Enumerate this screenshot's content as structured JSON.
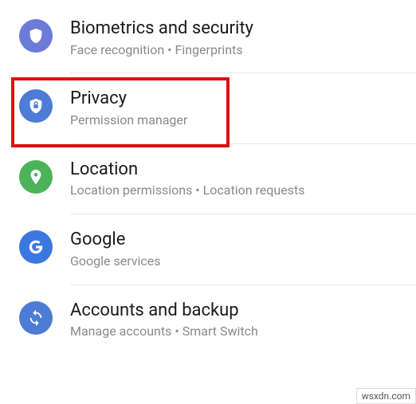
{
  "items": [
    {
      "title": "Biometrics and security",
      "subtitle": "Face recognition  •  Fingerprints",
      "icon": "shield",
      "color": "#6b7bd6"
    },
    {
      "title": "Privacy",
      "subtitle": "Permission manager",
      "icon": "lock-shield",
      "color": "#4d7cd6"
    },
    {
      "title": "Location",
      "subtitle": "Location permissions  •  Location requests",
      "icon": "pin",
      "color": "#4db35a"
    },
    {
      "title": "Google",
      "subtitle": "Google services",
      "icon": "google",
      "color": "#3a78e0"
    },
    {
      "title": "Accounts and backup",
      "subtitle": "Manage accounts  •  Smart Switch",
      "icon": "sync",
      "color": "#4d7cd6"
    }
  ],
  "watermark": "wsxdn.com"
}
